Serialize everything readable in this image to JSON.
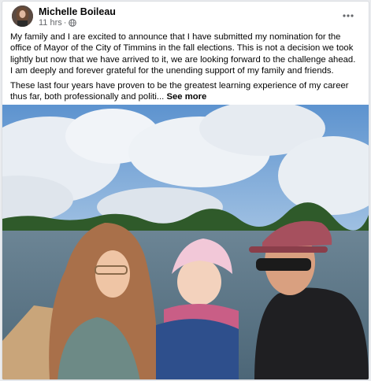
{
  "post": {
    "author": "Michelle Boileau",
    "timestamp": "11 hrs",
    "separator": "·",
    "privacy_icon": "globe-icon",
    "more_icon": "more-horizontal-icon",
    "paragraph_1": "My family and I are excited to announce that I have submitted my nomination for the office of Mayor of the City of Timmins in the fall elections. This is not a decision we took lightly but now that we have arrived to it, we are looking forward to the challenge ahead. I am deeply and forever grateful for the unending support of my family and friends.",
    "paragraph_2": "These last four years have proven to be the greatest learning experience of my career thus far, both professionally and politi...",
    "see_more": "See more"
  },
  "colors": {
    "author_text": "#050505",
    "meta_text": "#65676b",
    "sky": "#6f9fd4",
    "lake": "#5b7a8e"
  }
}
